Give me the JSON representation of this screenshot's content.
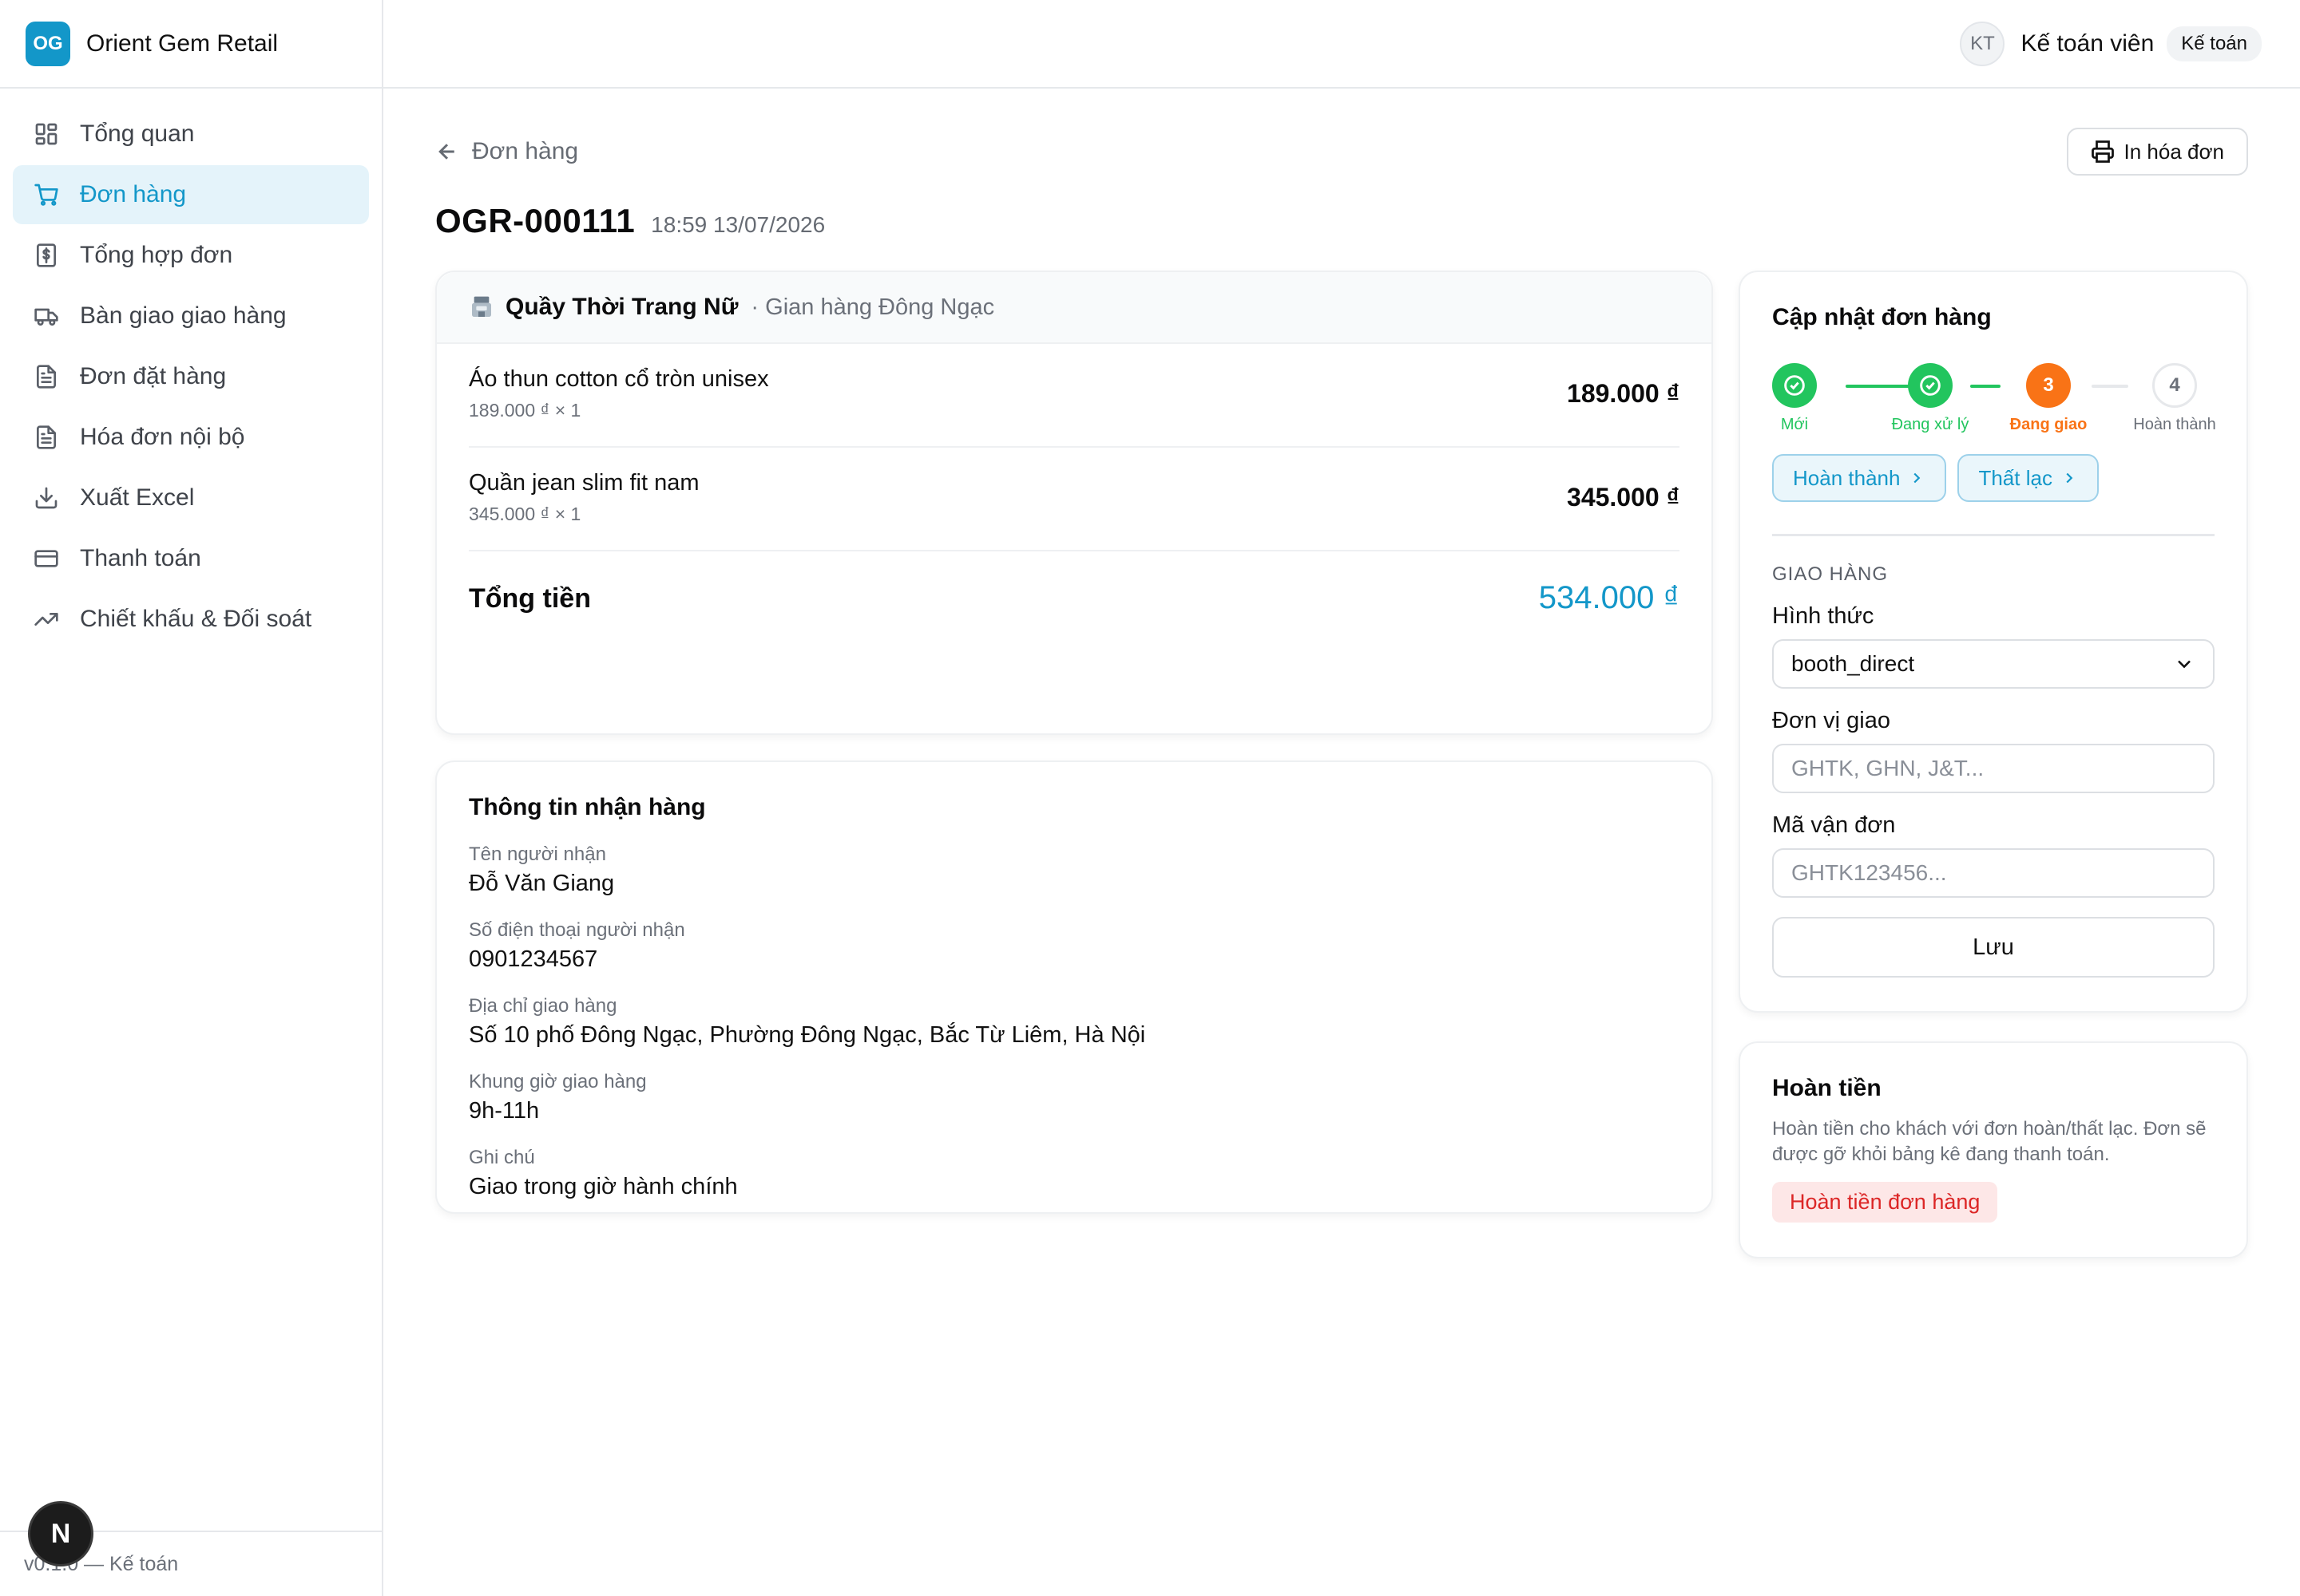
{
  "brand": {
    "logo": "OG",
    "name": "Orient Gem Retail"
  },
  "nav": [
    {
      "label": "Tổng quan",
      "icon": "dashboard-icon"
    },
    {
      "label": "Đơn hàng",
      "icon": "cart-icon",
      "active": true
    },
    {
      "label": "Tổng hợp đơn",
      "icon": "dollar-receipt-icon"
    },
    {
      "label": "Bàn giao giao hàng",
      "icon": "truck-icon"
    },
    {
      "label": "Đơn đặt hàng",
      "icon": "document-icon"
    },
    {
      "label": "Hóa đơn nội bộ",
      "icon": "document-icon"
    },
    {
      "label": "Xuất Excel",
      "icon": "download-icon"
    },
    {
      "label": "Thanh toán",
      "icon": "credit-card-icon"
    },
    {
      "label": "Chiết khấu & Đối soát",
      "icon": "trending-up-icon"
    }
  ],
  "footer": {
    "version": "v0.1.0 — Kế toán",
    "badge": "N"
  },
  "topbar": {
    "avatar": "KT",
    "user_name": "Kế toán viên",
    "role": "Kế toán"
  },
  "page": {
    "back_label": "Đơn hàng",
    "print_label": "In hóa đơn",
    "order_code": "OGR-000111",
    "order_time": "18:59 13/07/2026"
  },
  "items_card": {
    "store_name": "Quầy Thời Trang Nữ",
    "store_sub": "· Gian hàng Đông Ngạc",
    "items": [
      {
        "name": "Áo thun cotton cổ tròn unisex",
        "sub": "189.000 ₫ × 1",
        "price": "189.000 ₫"
      },
      {
        "name": "Quần jean slim fit nam",
        "sub": "345.000 ₫ × 1",
        "price": "345.000 ₫"
      }
    ],
    "total_label": "Tổng tiền",
    "total_value": "534.000 ₫"
  },
  "receiver": {
    "title": "Thông tin nhận hàng",
    "fields": [
      {
        "label": "Tên người nhận",
        "value": "Đỗ Văn Giang"
      },
      {
        "label": "Số điện thoại người nhận",
        "value": "0901234567"
      },
      {
        "label": "Địa chỉ giao hàng",
        "value": "Số 10 phố Đông Ngạc, Phường Đông Ngạc, Bắc Từ Liêm, Hà Nội"
      },
      {
        "label": "Khung giờ giao hàng",
        "value": "9h-11h"
      },
      {
        "label": "Ghi chú",
        "value": "Giao trong giờ hành chính"
      }
    ]
  },
  "update": {
    "title": "Cập nhật đơn hàng",
    "steps": [
      {
        "label": "Mới",
        "state": "done",
        "num": "1"
      },
      {
        "label": "Đang xử lý",
        "state": "done",
        "num": "2"
      },
      {
        "label": "Đang giao",
        "state": "current",
        "num": "3"
      },
      {
        "label": "Hoàn thành",
        "state": "todo",
        "num": "4"
      }
    ],
    "actions": [
      "Hoàn thành",
      "Thất lạc"
    ],
    "delivery_section": "GIAO HÀNG",
    "method_label": "Hình thức",
    "method_value": "booth_direct",
    "carrier_label": "Đơn vị giao",
    "carrier_placeholder": "GHTK, GHN, J&T...",
    "tracking_label": "Mã vận đơn",
    "tracking_placeholder": "GHTK123456...",
    "save_label": "Lưu"
  },
  "refund": {
    "title": "Hoàn tiền",
    "desc": "Hoàn tiền cho khách với đơn hoàn/thất lạc. Đơn sẽ được gỡ khỏi bảng kê đang thanh toán.",
    "button": "Hoàn tiền đơn hàng"
  },
  "colors": {
    "accent": "#1397c9",
    "step_done": "#22c55e",
    "step_current": "#f97316",
    "refund_text": "#dc2626",
    "refund_bg": "#fde7e7"
  }
}
